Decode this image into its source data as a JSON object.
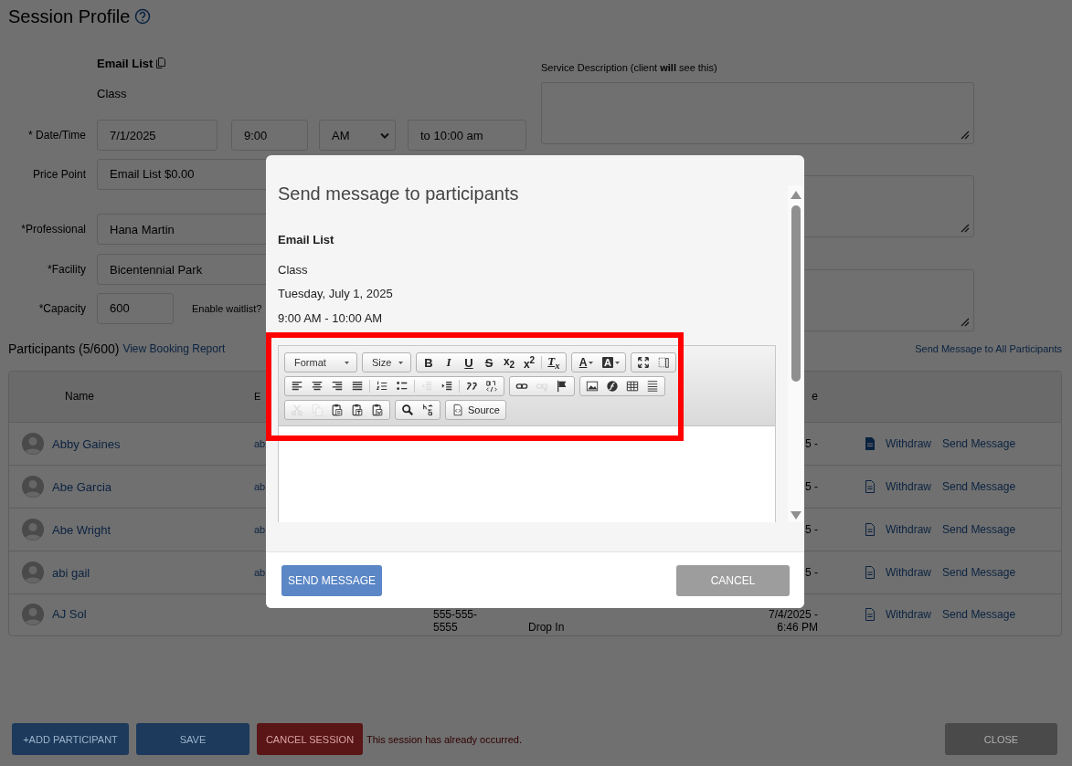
{
  "page": {
    "title": "Session Profile"
  },
  "session": {
    "name": "Email List",
    "type": "Class"
  },
  "form": {
    "date_time": {
      "label": "* Date/Time",
      "date": "7/1/2025",
      "time": "9:00",
      "meridiem": "AM",
      "end": "to 10:00 am"
    },
    "price_point": {
      "label": "Price Point",
      "value": "Email List $0.00"
    },
    "professional": {
      "label": "*Professional",
      "value": "Hana Martin"
    },
    "facility": {
      "label": "*Facility",
      "value": "Bicentennial Park"
    },
    "capacity": {
      "label": "*Capacity",
      "value": "600"
    },
    "waitlist": {
      "label": "Enable waitlist?"
    },
    "service_description": {
      "label": "Service Description (client **will** see this)"
    }
  },
  "participants": {
    "heading": "Participants (5/600)",
    "report_link": "View Booking Report",
    "message_all_link": "Send Message to All Participants",
    "columns": [
      "Name",
      "E",
      "e"
    ],
    "rows": [
      {
        "name": "Abby Gaines",
        "email": "ab",
        "date": "5 -",
        "document_filled": true,
        "actions": [
          "Withdraw",
          "Send Message"
        ]
      },
      {
        "name": "Abe Garcia",
        "email": "ab",
        "date": "5 -",
        "document_filled": false,
        "actions": [
          "Withdraw",
          "Send Message"
        ]
      },
      {
        "name": "Abe Wright",
        "email": "ab",
        "date": "5 -",
        "document_filled": false,
        "actions": [
          "Withdraw",
          "Send Message"
        ]
      },
      {
        "name": "abi gail",
        "email": "ab",
        "date": "5 -",
        "document_filled": false,
        "actions": [
          "Withdraw",
          "Send Message"
        ]
      },
      {
        "name": "AJ Sol",
        "phone": "555-555-5555",
        "type": "Drop In",
        "date": "7/4/2025 - 6:46 PM",
        "document_filled": false,
        "actions": [
          "Withdraw",
          "Send Message"
        ]
      }
    ]
  },
  "action_bar": {
    "buttons": [
      {
        "label": "+ADD PARTICIPANT",
        "kind": "primary"
      },
      {
        "label": "SAVE",
        "kind": "primary"
      },
      {
        "label": "CANCEL SESSION",
        "kind": "danger"
      }
    ],
    "notice": "This session has already occurred.",
    "close": "CLOSE"
  },
  "modal": {
    "title": "Send message to participants",
    "session_name": "Email List",
    "session_type": "Class",
    "date": "Tuesday, July 1, 2025",
    "time": "9:00 AM - 10:00 AM",
    "toolbar": [
      {
        "groups": [
          {
            "items": [
              {
                "kind": "combo",
                "label": "Format",
                "disabled": false
              }
            ]
          },
          {
            "items": [
              {
                "kind": "combo",
                "label": "Size",
                "disabled": false
              }
            ]
          },
          {
            "items": [
              {
                "kind": "bold",
                "label": "B",
                "disabled": false
              },
              {
                "kind": "italic",
                "label": "I",
                "disabled": false
              },
              {
                "kind": "underline",
                "label": "U",
                "disabled": false
              },
              {
                "kind": "strike",
                "label": "S",
                "disabled": false
              },
              {
                "kind": "subscript",
                "label": "x$_{2}$",
                "disabled": false
              },
              {
                "kind": "superscript",
                "label": "x$^{2}$",
                "disabled": false
              },
              {
                "kind": "separator"
              },
              {
                "kind": "clear-format",
                "label": "T$_{x}$",
                "disabled": false
              }
            ]
          },
          {
            "items": [
              {
                "kind": "text-color",
                "label": "A",
                "disabled": false
              },
              {
                "kind": "bg-color",
                "label": "A",
                "disabled": false
              }
            ]
          },
          {
            "items": [
              {
                "kind": "maximize",
                "disabled": false
              },
              {
                "kind": "show-blocks",
                "disabled": false
              }
            ]
          }
        ]
      },
      {
        "groups": [
          {
            "items": [
              {
                "kind": "align-left",
                "disabled": false
              },
              {
                "kind": "align-center",
                "disabled": false
              },
              {
                "kind": "align-right",
                "disabled": false
              },
              {
                "kind": "justify",
                "disabled": false
              },
              {
                "kind": "separator"
              },
              {
                "kind": "numbered-list",
                "disabled": false
              },
              {
                "kind": "bulleted-list",
                "disabled": false
              },
              {
                "kind": "separator"
              },
              {
                "kind": "outdent",
                "disabled": true
              },
              {
                "kind": "indent",
                "disabled": false
              },
              {
                "kind": "separator"
              },
              {
                "kind": "blockquote",
                "disabled": false
              },
              {
                "kind": "div",
                "disabled": false
              }
            ]
          },
          {
            "items": [
              {
                "kind": "link",
                "disabled": false
              },
              {
                "kind": "unlink",
                "disabled": true
              },
              {
                "kind": "anchor",
                "disabled": false
              }
            ]
          },
          {
            "items": [
              {
                "kind": "image",
                "disabled": false
              },
              {
                "kind": "flash",
                "disabled": false
              },
              {
                "kind": "table",
                "disabled": false
              },
              {
                "kind": "horizontal-rule",
                "disabled": false
              }
            ]
          }
        ]
      },
      {
        "groups": [
          {
            "items": [
              {
                "kind": "cut",
                "disabled": true
              },
              {
                "kind": "copy",
                "disabled": true
              },
              {
                "kind": "paste",
                "disabled": false
              },
              {
                "kind": "paste-text",
                "disabled": false
              },
              {
                "kind": "paste-word",
                "disabled": false
              }
            ]
          },
          {
            "items": [
              {
                "kind": "find",
                "disabled": false
              },
              {
                "kind": "replace",
                "disabled": false
              }
            ]
          },
          {
            "items": [
              {
                "kind": "source",
                "label": "Source",
                "disabled": false
              }
            ]
          }
        ]
      }
    ],
    "buttons": [
      {
        "label": "SEND MESSAGE",
        "kind": "primary"
      },
      {
        "label": "CANCEL",
        "kind": "secondary"
      }
    ]
  }
}
